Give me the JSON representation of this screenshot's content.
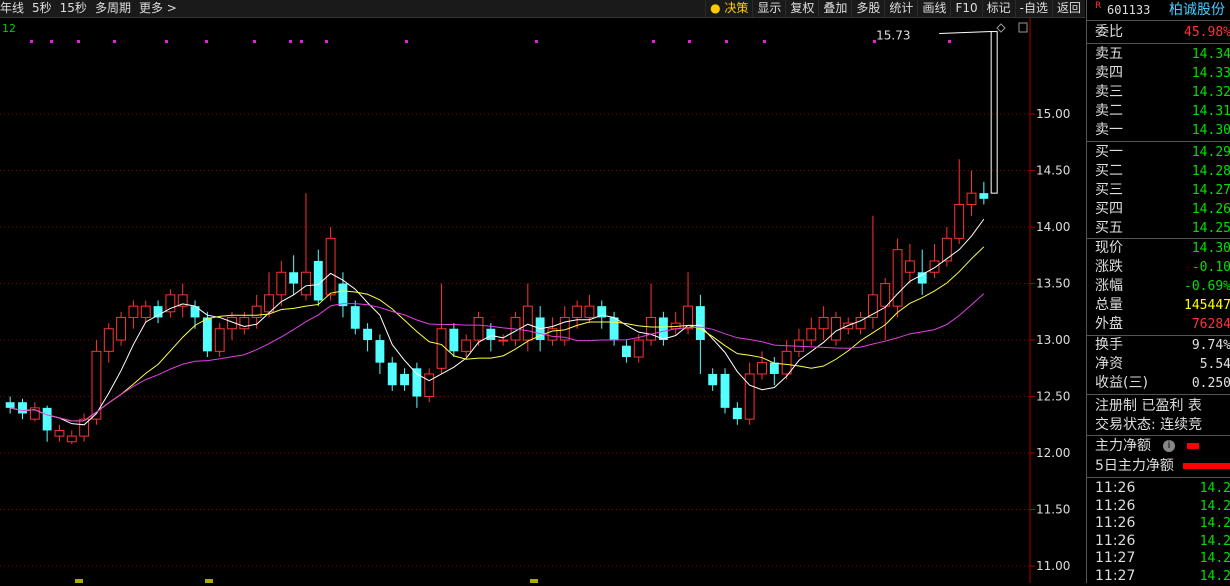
{
  "toolbar": {
    "left_items": [
      "年线",
      "5秒",
      "15秒",
      "多周期",
      "更多"
    ],
    "right_items": [
      "决策",
      "显示",
      "复权",
      "叠加",
      "多股",
      "统计",
      "画线",
      "F10",
      "标记",
      "-自选",
      "返回"
    ]
  },
  "chart_data": {
    "type": "candlestick",
    "y_ticks": [
      "15.00",
      "14.50",
      "14.00",
      "13.50",
      "13.00",
      "12.50",
      "12.00",
      "11.50",
      "11.00"
    ],
    "ylim": [
      10.85,
      15.85
    ],
    "max_label": "15.73",
    "corner_label": "12",
    "candles": [
      [
        12.45,
        12.4,
        12.5,
        12.35
      ],
      [
        12.45,
        12.35,
        12.48,
        12.3
      ],
      [
        12.3,
        12.4,
        12.45,
        12.28
      ],
      [
        12.4,
        12.2,
        12.42,
        12.1
      ],
      [
        12.15,
        12.2,
        12.25,
        12.1
      ],
      [
        12.1,
        12.15,
        12.2,
        12.08
      ],
      [
        12.15,
        12.3,
        12.35,
        12.1
      ],
      [
        12.3,
        12.9,
        13.0,
        12.25
      ],
      [
        12.9,
        13.1,
        13.15,
        12.8
      ],
      [
        13.0,
        13.2,
        13.25,
        12.95
      ],
      [
        13.2,
        13.3,
        13.35,
        13.1
      ],
      [
        13.2,
        13.3,
        13.35,
        13.15
      ],
      [
        13.3,
        13.2,
        13.35,
        13.15
      ],
      [
        13.25,
        13.4,
        13.45,
        13.2
      ],
      [
        13.3,
        13.4,
        13.5,
        13.2
      ],
      [
        13.3,
        13.2,
        13.35,
        13.1
      ],
      [
        13.2,
        12.9,
        13.25,
        12.85
      ],
      [
        12.9,
        13.1,
        13.15,
        12.85
      ],
      [
        13.1,
        13.2,
        13.25,
        13.0
      ],
      [
        13.1,
        13.2,
        13.25,
        13.05
      ],
      [
        13.2,
        13.3,
        13.4,
        13.1
      ],
      [
        13.25,
        13.4,
        13.6,
        13.2
      ],
      [
        13.4,
        13.6,
        13.7,
        13.3
      ],
      [
        13.6,
        13.5,
        13.75,
        13.4
      ],
      [
        13.4,
        13.6,
        14.3,
        13.35
      ],
      [
        13.7,
        13.35,
        13.8,
        13.3
      ],
      [
        13.4,
        13.9,
        14.0,
        13.35
      ],
      [
        13.5,
        13.3,
        13.6,
        13.2
      ],
      [
        13.3,
        13.1,
        13.35,
        13.05
      ],
      [
        13.1,
        13.0,
        13.15,
        12.9
      ],
      [
        13.0,
        12.8,
        13.05,
        12.7
      ],
      [
        12.8,
        12.6,
        12.85,
        12.55
      ],
      [
        12.7,
        12.6,
        12.75,
        12.55
      ],
      [
        12.75,
        12.5,
        12.8,
        12.4
      ],
      [
        12.5,
        12.7,
        12.75,
        12.45
      ],
      [
        12.75,
        13.1,
        13.5,
        12.7
      ],
      [
        13.1,
        12.9,
        13.15,
        12.85
      ],
      [
        12.9,
        13.0,
        13.05,
        12.85
      ],
      [
        13.0,
        13.2,
        13.25,
        12.95
      ],
      [
        13.1,
        13.0,
        13.15,
        12.9
      ],
      [
        13.0,
        13.0,
        13.05,
        12.95
      ],
      [
        13.0,
        13.2,
        13.25,
        12.95
      ],
      [
        13.0,
        13.3,
        13.5,
        12.9
      ],
      [
        13.2,
        13.0,
        13.3,
        12.9
      ],
      [
        13.0,
        13.1,
        13.2,
        12.95
      ],
      [
        13.0,
        13.2,
        13.3,
        12.95
      ],
      [
        13.2,
        13.3,
        13.35,
        13.1
      ],
      [
        13.2,
        13.3,
        13.4,
        13.15
      ],
      [
        13.3,
        13.2,
        13.35,
        13.1
      ],
      [
        13.2,
        13.0,
        13.25,
        12.95
      ],
      [
        12.95,
        12.85,
        13.0,
        12.8
      ],
      [
        12.85,
        13.0,
        13.05,
        12.8
      ],
      [
        13.0,
        13.2,
        13.5,
        12.95
      ],
      [
        13.2,
        13.0,
        13.25,
        12.95
      ],
      [
        13.1,
        13.15,
        13.25,
        13.05
      ],
      [
        13.1,
        13.3,
        13.6,
        13.05
      ],
      [
        13.3,
        13.0,
        13.4,
        12.7
      ],
      [
        12.7,
        12.6,
        12.75,
        12.55
      ],
      [
        12.7,
        12.4,
        12.75,
        12.35
      ],
      [
        12.4,
        12.3,
        12.45,
        12.25
      ],
      [
        12.3,
        12.7,
        12.8,
        12.25
      ],
      [
        12.7,
        12.8,
        12.9,
        12.65
      ],
      [
        12.8,
        12.7,
        12.85,
        12.6
      ],
      [
        12.7,
        12.9,
        13.0,
        12.65
      ],
      [
        12.9,
        13.0,
        13.1,
        12.85
      ],
      [
        13.0,
        13.1,
        13.2,
        12.95
      ],
      [
        13.1,
        13.2,
        13.3,
        13.0
      ],
      [
        13.0,
        13.2,
        13.25,
        12.95
      ],
      [
        13.1,
        13.15,
        13.2,
        13.05
      ],
      [
        13.1,
        13.2,
        13.25,
        13.05
      ],
      [
        13.2,
        13.4,
        14.1,
        13.1
      ],
      [
        13.3,
        13.5,
        13.55,
        13.0
      ],
      [
        13.3,
        13.8,
        13.9,
        13.2
      ],
      [
        13.6,
        13.7,
        13.85,
        13.5
      ],
      [
        13.6,
        13.5,
        13.8,
        13.4
      ],
      [
        13.6,
        13.7,
        13.85,
        13.55
      ],
      [
        13.7,
        13.9,
        14.0,
        13.65
      ],
      [
        13.9,
        14.2,
        14.6,
        13.85
      ],
      [
        14.2,
        14.3,
        14.5,
        14.1
      ],
      [
        14.3,
        14.25,
        14.4,
        14.2
      ]
    ]
  },
  "panel": {
    "stock_code": "601133",
    "stock_name": "柏诚股份",
    "corner_mark": "R",
    "weibi_label": "委比",
    "weibi_value": "45.98%",
    "sell": [
      {
        "label": "卖五",
        "price": "14.34"
      },
      {
        "label": "卖四",
        "price": "14.33"
      },
      {
        "label": "卖三",
        "price": "14.32"
      },
      {
        "label": "卖二",
        "price": "14.31"
      },
      {
        "label": "卖一",
        "price": "14.30"
      }
    ],
    "buy": [
      {
        "label": "买一",
        "price": "14.29"
      },
      {
        "label": "买二",
        "price": "14.28"
      },
      {
        "label": "买三",
        "price": "14.27"
      },
      {
        "label": "买四",
        "price": "14.26"
      },
      {
        "label": "买五",
        "price": "14.25"
      }
    ],
    "stats": [
      {
        "label": "现价",
        "value": "14.30",
        "cls": "g"
      },
      {
        "label": "涨跌",
        "value": "-0.10",
        "cls": "g"
      },
      {
        "label": "涨幅",
        "value": "-0.69%",
        "cls": "g"
      },
      {
        "label": "总量",
        "value": "145447",
        "cls": "y"
      },
      {
        "label": "外盘",
        "value": "76284",
        "cls": "r"
      }
    ],
    "stats2": [
      {
        "label": "换手",
        "value": "9.74%",
        "cls": "w"
      },
      {
        "label": "净资",
        "value": "5.54",
        "cls": "w"
      },
      {
        "label": "收益(三)",
        "value": "0.250",
        "cls": "w"
      }
    ],
    "tags": "注册制  已盈利  表",
    "trade_status": "交易状态: 连续竞",
    "main_net": "主力净额",
    "main_net_5d": "5日主力净额",
    "ticks": [
      {
        "time": "11:26",
        "price": "14.2"
      },
      {
        "time": "11:26",
        "price": "14.2"
      },
      {
        "time": "11:26",
        "price": "14.2"
      },
      {
        "time": "11:26",
        "price": "14.2"
      },
      {
        "time": "11:27",
        "price": "14.2"
      },
      {
        "time": "11:27",
        "price": "14.2"
      }
    ]
  }
}
